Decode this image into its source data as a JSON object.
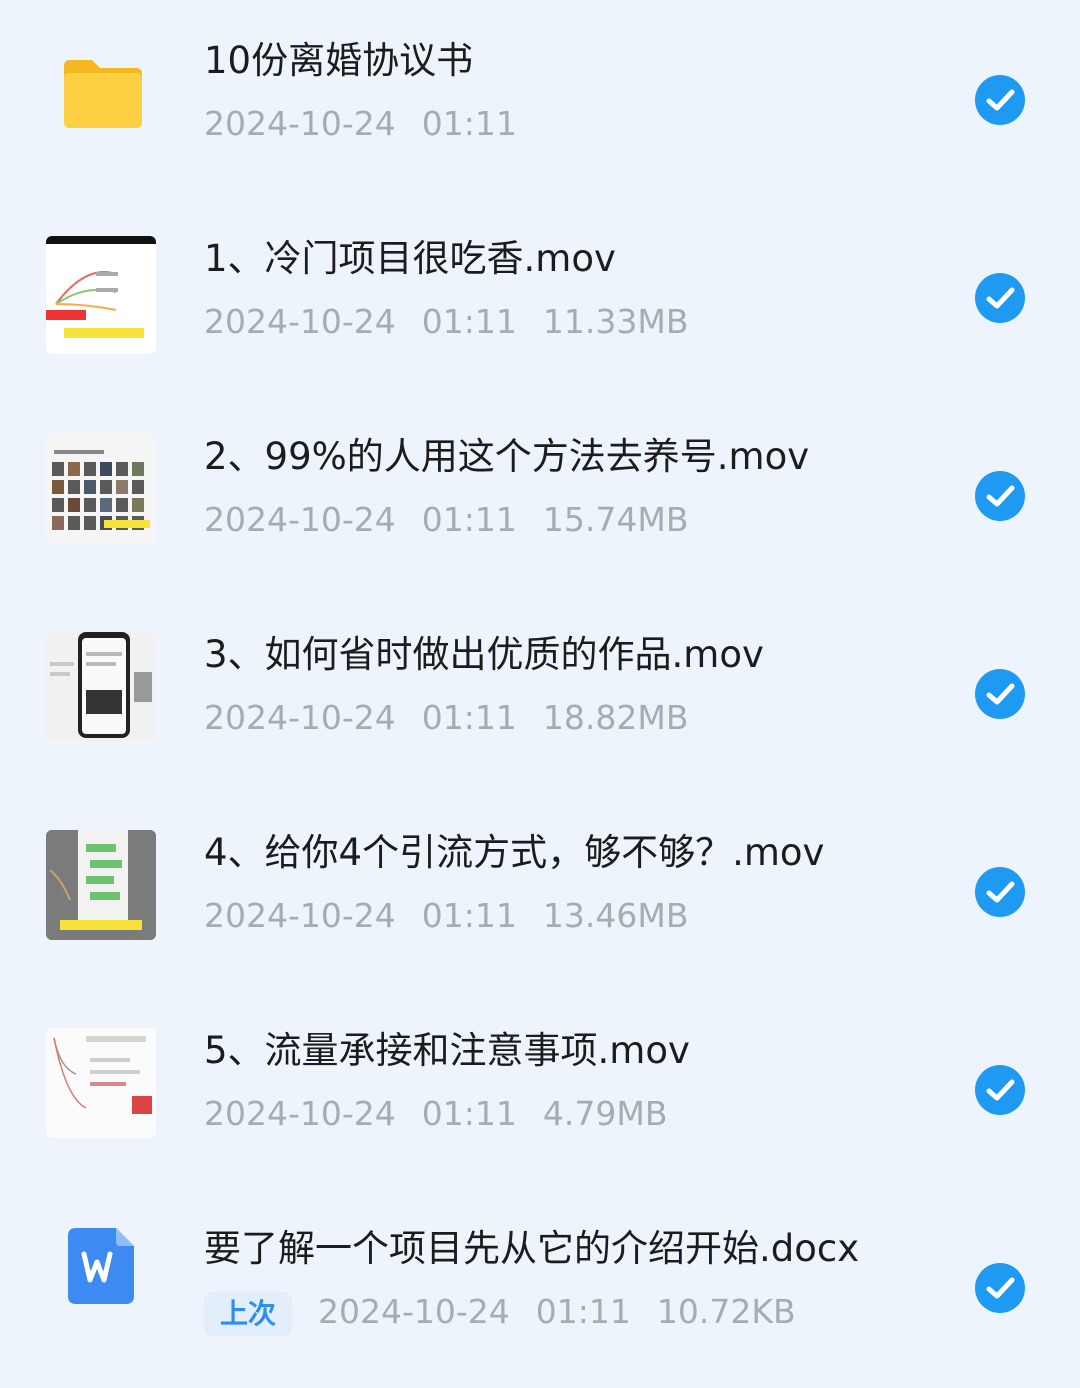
{
  "colors": {
    "background": "#eef4fb",
    "check": "#1f9af3",
    "folder": "#fdc830",
    "word": "#3d8bf2"
  },
  "files": [
    {
      "icon": "folder-icon",
      "name": "10份离婚协议书",
      "date": "2024-10-24",
      "time": "01:11",
      "size": "",
      "badge": "",
      "selected": true
    },
    {
      "icon": "video-thumbnail",
      "name": "1、冷门项目很吃香.mov",
      "date": "2024-10-24",
      "time": "01:11",
      "size": "11.33MB",
      "badge": "",
      "selected": true
    },
    {
      "icon": "video-thumbnail",
      "name": "2、99%的人用这个方法去养号.mov",
      "date": "2024-10-24",
      "time": "01:11",
      "size": "15.74MB",
      "badge": "",
      "selected": true
    },
    {
      "icon": "video-thumbnail",
      "name": "3、如何省时做出优质的作品.mov",
      "date": "2024-10-24",
      "time": "01:11",
      "size": "18.82MB",
      "badge": "",
      "selected": true
    },
    {
      "icon": "video-thumbnail",
      "name": "4、给你4个引流方式，够不够？.mov",
      "date": "2024-10-24",
      "time": "01:11",
      "size": "13.46MB",
      "badge": "",
      "selected": true
    },
    {
      "icon": "video-thumbnail",
      "name": "5、流量承接和注意事项.mov",
      "date": "2024-10-24",
      "time": "01:11",
      "size": "4.79MB",
      "badge": "",
      "selected": true
    },
    {
      "icon": "word-doc-icon",
      "name": "要了解一个项目先从它的介绍开始.docx",
      "date": "2024-10-24",
      "time": "01:11",
      "size": "10.72KB",
      "badge": "上次",
      "selected": true
    }
  ]
}
